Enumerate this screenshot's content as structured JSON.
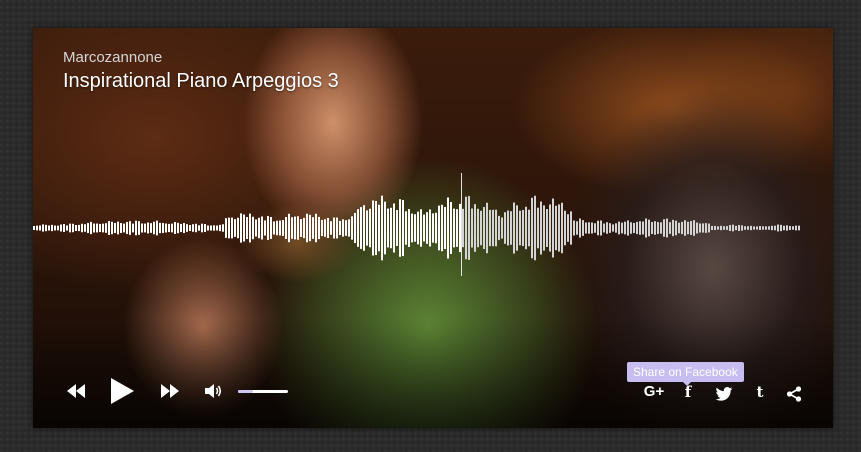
{
  "player": {
    "artist": "Marcozannone",
    "title": "Inspirational Piano Arpeggios 3",
    "progress": 0.555,
    "volume": 0.3,
    "colors": {
      "played": "#ffffff",
      "unplayed": "#d4d4d4",
      "accent": "#c8bdf0"
    }
  },
  "controls": {
    "rewind_icon": "rewind-icon",
    "play_icon": "play-icon",
    "forward_icon": "fast-forward-icon",
    "volume_icon": "volume-icon"
  },
  "share": {
    "tooltip": "Share on Facebook",
    "google_label": "G+",
    "facebook_label": "f",
    "tumblr_label": "t",
    "twitter_icon": "twitter-icon",
    "share_icon": "share-icon"
  }
}
